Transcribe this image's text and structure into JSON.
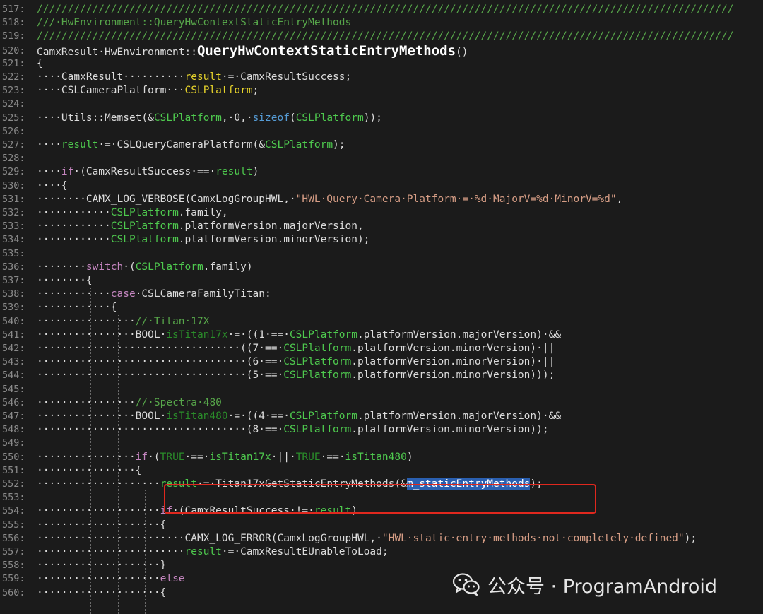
{
  "highlight_color": "#e0281e",
  "lines": [
    {
      "n": "517:",
      "segs": [
        [
          "cmt",
          "/////////////////////////////////////////////////////////////////////////////////////////////////////////////////"
        ]
      ]
    },
    {
      "n": "518:",
      "segs": [
        [
          "cmt",
          "///·HwEnvironment::QueryHwContextStaticEntryMethods"
        ]
      ]
    },
    {
      "n": "519:",
      "segs": [
        [
          "cmt",
          "/////////////////////////////////////////////////////////////////////////////////////////////////////////////////"
        ]
      ]
    },
    {
      "n": "520:",
      "segs": [
        [
          "",
          "CamxResult·HwEnvironment::"
        ],
        [
          "fn",
          "QueryHwContextStaticEntryMethods"
        ],
        [
          "",
          "()"
        ]
      ]
    },
    {
      "n": "521:",
      "segs": [
        [
          "",
          "{"
        ]
      ]
    },
    {
      "n": "522:",
      "segs": [
        [
          "",
          "····CamxResult··········"
        ],
        [
          "y",
          "result"
        ],
        [
          "",
          "·=·CamxResultSuccess;"
        ]
      ]
    },
    {
      "n": "523:",
      "segs": [
        [
          "",
          "····CSLCameraPlatform···"
        ],
        [
          "y",
          "CSLPlatform"
        ],
        [
          "",
          ";"
        ]
      ]
    },
    {
      "n": "524:",
      "segs": []
    },
    {
      "n": "525:",
      "segs": [
        [
          "",
          "····Utils::Memset(&"
        ],
        [
          "g",
          "CSLPlatform"
        ],
        [
          "",
          ",·0,·"
        ],
        [
          "blue",
          "sizeof"
        ],
        [
          "",
          "("
        ],
        [
          "g",
          "CSLPlatform"
        ],
        [
          "",
          "));"
        ]
      ]
    },
    {
      "n": "526:",
      "segs": []
    },
    {
      "n": "527:",
      "segs": [
        [
          "",
          "····"
        ],
        [
          "g",
          "result"
        ],
        [
          "",
          "·=·CSLQueryCameraPlatform(&"
        ],
        [
          "g",
          "CSLPlatform"
        ],
        [
          "",
          ");"
        ]
      ]
    },
    {
      "n": "528:",
      "segs": []
    },
    {
      "n": "529:",
      "segs": [
        [
          "",
          "····"
        ],
        [
          "kw",
          "if"
        ],
        [
          "",
          "·(CamxResultSuccess·==·"
        ],
        [
          "g",
          "result"
        ],
        [
          "",
          ")"
        ]
      ]
    },
    {
      "n": "530:",
      "segs": [
        [
          "",
          "····{"
        ]
      ]
    },
    {
      "n": "531:",
      "segs": [
        [
          "",
          "········CAMX_LOG_VERBOSE(CamxLogGroupHWL,·"
        ],
        [
          "str",
          "\"HWL·Query·Camera·Platform·=·%d·MajorV=%d·MinorV=%d\""
        ],
        [
          "",
          ","
        ]
      ]
    },
    {
      "n": "532:",
      "segs": [
        [
          "",
          "············"
        ],
        [
          "g",
          "CSLPlatform"
        ],
        [
          "",
          ".family,"
        ]
      ]
    },
    {
      "n": "533:",
      "segs": [
        [
          "",
          "············"
        ],
        [
          "g",
          "CSLPlatform"
        ],
        [
          "",
          ".platformVersion.majorVersion,"
        ]
      ]
    },
    {
      "n": "534:",
      "segs": [
        [
          "",
          "············"
        ],
        [
          "g",
          "CSLPlatform"
        ],
        [
          "",
          ".platformVersion.minorVersion);"
        ]
      ]
    },
    {
      "n": "535:",
      "segs": []
    },
    {
      "n": "536:",
      "segs": [
        [
          "",
          "········"
        ],
        [
          "kw",
          "switch"
        ],
        [
          "",
          "·("
        ],
        [
          "g",
          "CSLPlatform"
        ],
        [
          "",
          ".family)"
        ]
      ]
    },
    {
      "n": "537:",
      "segs": [
        [
          "",
          "········{"
        ]
      ]
    },
    {
      "n": "538:",
      "segs": [
        [
          "",
          "············"
        ],
        [
          "kw",
          "case"
        ],
        [
          "",
          "·CSLCameraFamilyTitan:"
        ]
      ]
    },
    {
      "n": "539:",
      "segs": [
        [
          "",
          "············{"
        ]
      ]
    },
    {
      "n": "540:",
      "segs": [
        [
          "",
          "················"
        ],
        [
          "cmt",
          "//·Titan·17X"
        ]
      ]
    },
    {
      "n": "541:",
      "segs": [
        [
          "",
          "················BOOL·"
        ],
        [
          "dg",
          "isTitan17x"
        ],
        [
          "",
          "·=·((1·==·"
        ],
        [
          "g",
          "CSLPlatform"
        ],
        [
          "",
          ".platformVersion.majorVersion)·&&"
        ]
      ]
    },
    {
      "n": "542:",
      "segs": [
        [
          "",
          "·································((7·==·"
        ],
        [
          "g",
          "CSLPlatform"
        ],
        [
          "",
          ".platformVersion.minorVersion)·||"
        ]
      ]
    },
    {
      "n": "543:",
      "segs": [
        [
          "",
          "··································(6·==·"
        ],
        [
          "g",
          "CSLPlatform"
        ],
        [
          "",
          ".platformVersion.minorVersion)·||"
        ]
      ]
    },
    {
      "n": "544:",
      "segs": [
        [
          "",
          "··································(5·==·"
        ],
        [
          "g",
          "CSLPlatform"
        ],
        [
          "",
          ".platformVersion.minorVersion)));"
        ]
      ]
    },
    {
      "n": "545:",
      "segs": []
    },
    {
      "n": "546:",
      "segs": [
        [
          "",
          "················"
        ],
        [
          "cmt",
          "//·Spectra·480"
        ]
      ]
    },
    {
      "n": "547:",
      "segs": [
        [
          "",
          "················BOOL·"
        ],
        [
          "dg",
          "isTitan480"
        ],
        [
          "",
          "·=·((4·==·"
        ],
        [
          "g",
          "CSLPlatform"
        ],
        [
          "",
          ".platformVersion.majorVersion)·&&"
        ]
      ]
    },
    {
      "n": "548:",
      "segs": [
        [
          "",
          "··································(8·==·"
        ],
        [
          "g",
          "CSLPlatform"
        ],
        [
          "",
          ".platformVersion.minorVersion));"
        ]
      ]
    },
    {
      "n": "549:",
      "segs": []
    },
    {
      "n": "550:",
      "segs": [
        [
          "",
          "················"
        ],
        [
          "kw",
          "if"
        ],
        [
          "",
          "·("
        ],
        [
          "dg",
          "TRUE"
        ],
        [
          "",
          "·==·"
        ],
        [
          "g",
          "isTitan17x"
        ],
        [
          "",
          "·||·"
        ],
        [
          "dg",
          "TRUE"
        ],
        [
          "",
          "·==·"
        ],
        [
          "g",
          "isTitan480"
        ],
        [
          "",
          ")"
        ]
      ]
    },
    {
      "n": "551:",
      "segs": [
        [
          "",
          "················{"
        ]
      ]
    },
    {
      "n": "552:",
      "segs": [
        [
          "",
          "····················"
        ],
        [
          "g",
          "result"
        ],
        [
          "",
          "·=·Titan17xGetStaticEntryMethods(&"
        ],
        [
          "hl",
          "m_staticEntryMethods"
        ],
        [
          "",
          ");"
        ]
      ]
    },
    {
      "n": "553:",
      "segs": []
    },
    {
      "n": "554:",
      "segs": [
        [
          "",
          "····················"
        ],
        [
          "kw",
          "if"
        ],
        [
          "",
          "·(CamxResultSuccess·!=·"
        ],
        [
          "g",
          "result"
        ],
        [
          "",
          ")"
        ]
      ]
    },
    {
      "n": "555:",
      "segs": [
        [
          "",
          "····················{"
        ]
      ]
    },
    {
      "n": "556:",
      "segs": [
        [
          "",
          "························CAMX_LOG_ERROR(CamxLogGroupHWL,·"
        ],
        [
          "str",
          "\"HWL·static·entry·methods·not·completely·defined\""
        ],
        [
          "",
          ");"
        ]
      ]
    },
    {
      "n": "557:",
      "segs": [
        [
          "",
          "························"
        ],
        [
          "g",
          "result"
        ],
        [
          "",
          "·=·CamxResultEUnableToLoad;"
        ]
      ]
    },
    {
      "n": "558:",
      "segs": [
        [
          "",
          "····················}"
        ]
      ]
    },
    {
      "n": "559:",
      "segs": [
        [
          "",
          "····················"
        ],
        [
          "kw",
          "else"
        ]
      ]
    },
    {
      "n": "560:",
      "segs": [
        [
          "",
          "····················{"
        ]
      ]
    }
  ],
  "watermark": {
    "icon": "wechat-icon",
    "text": "公众号 · ProgramAndroid"
  }
}
